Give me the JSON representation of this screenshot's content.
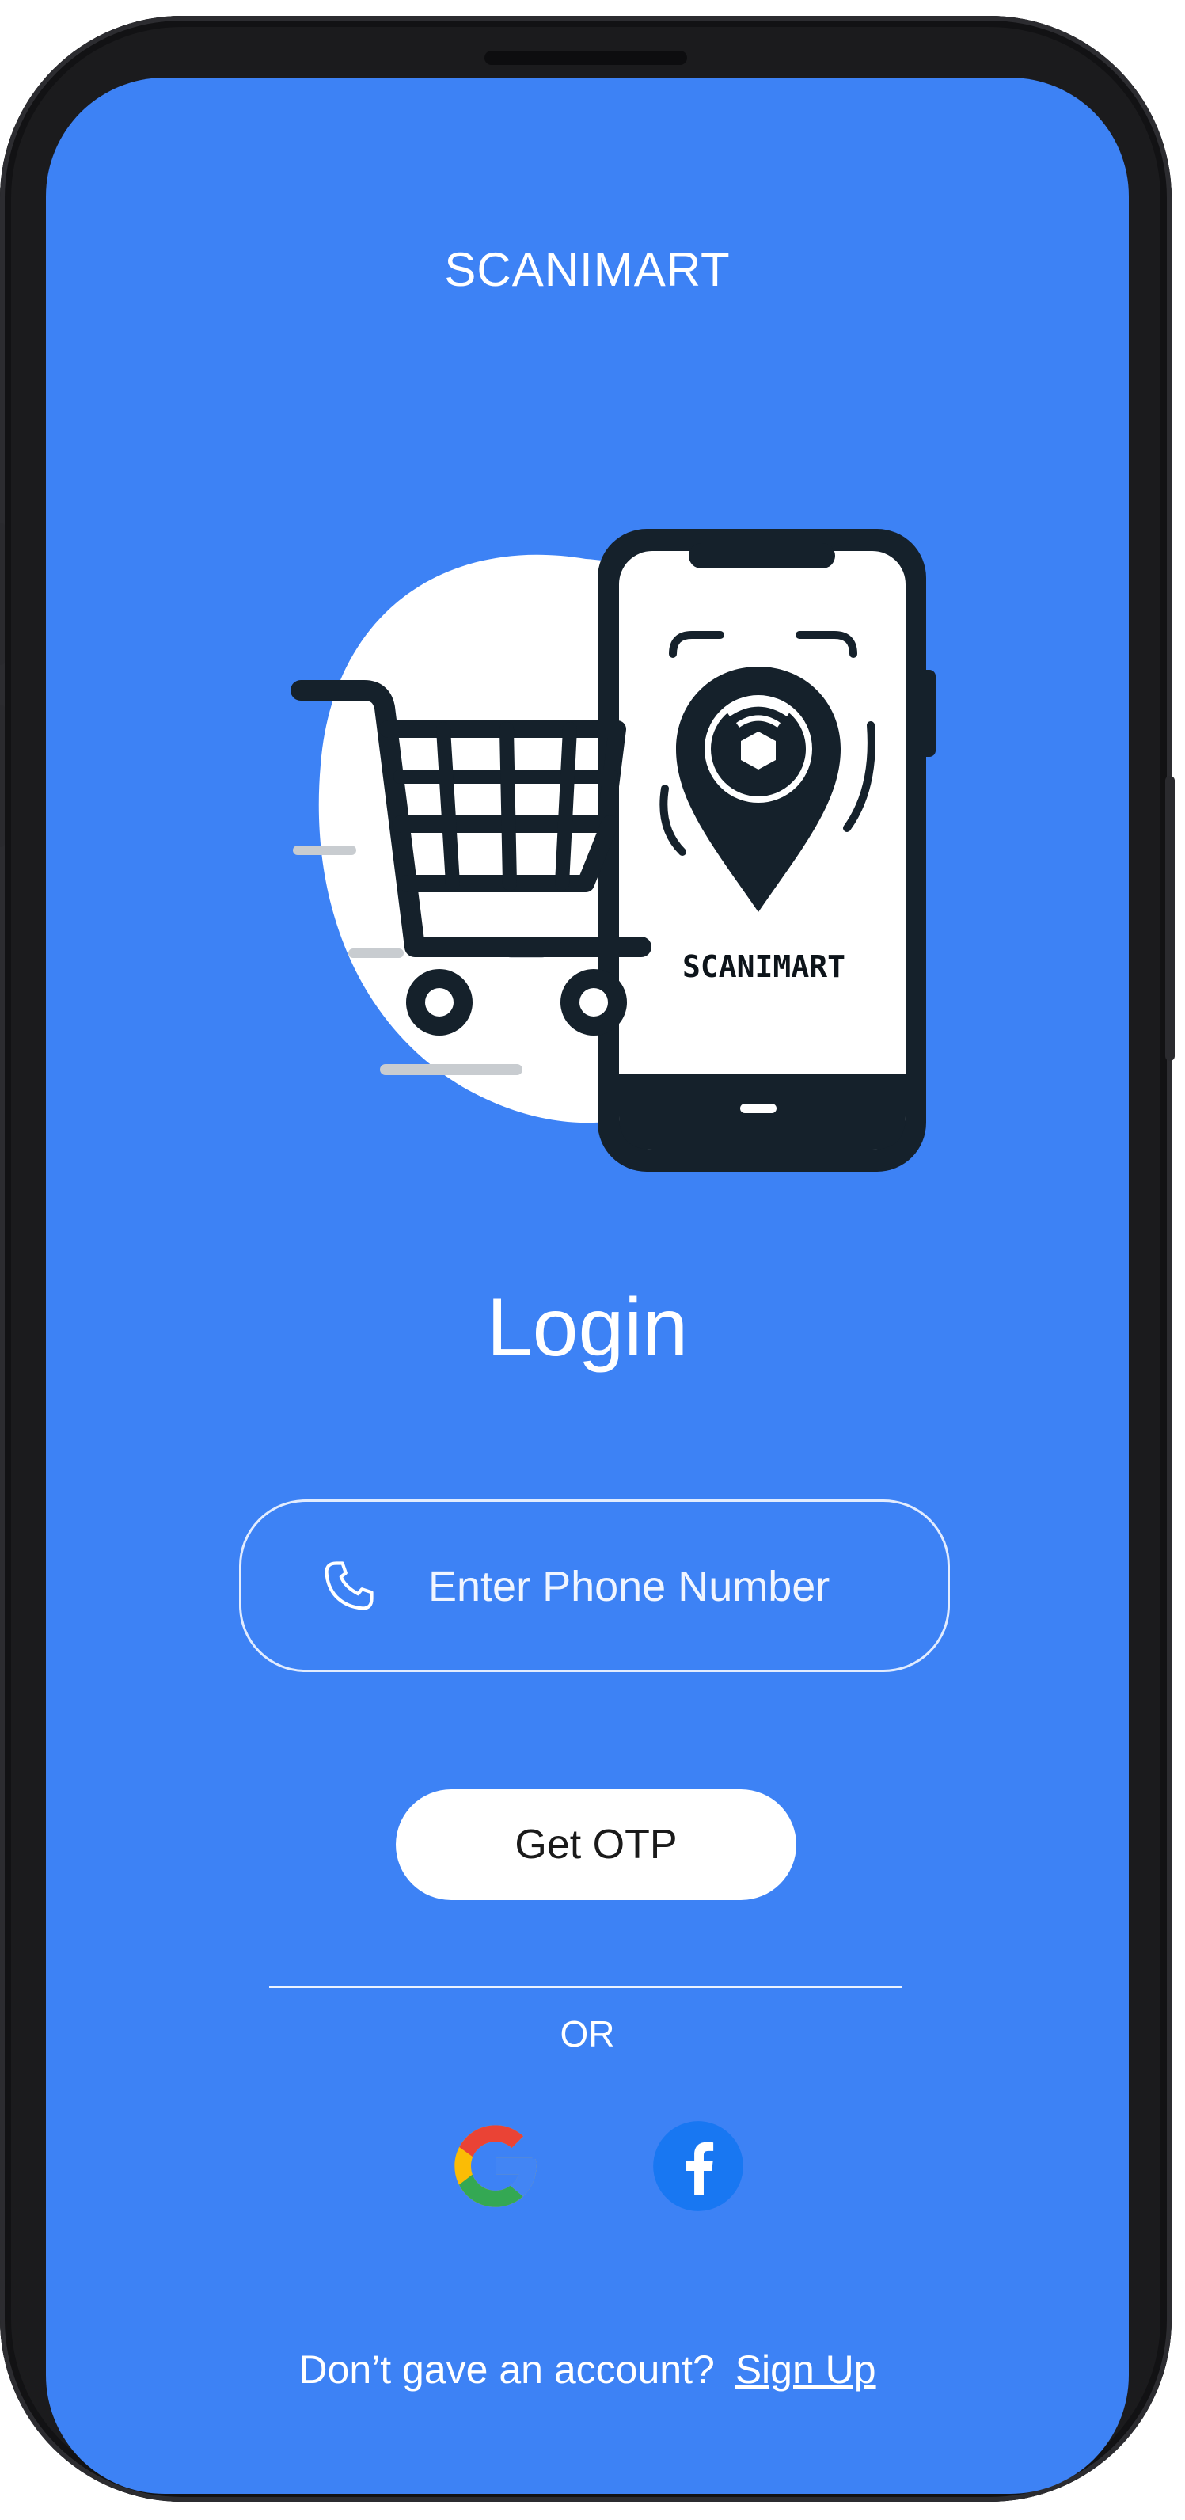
{
  "app": {
    "title": "SCANIMART",
    "logo_text": "SCANIMART"
  },
  "login": {
    "title": "Login",
    "phone_placeholder": "Enter Phone Number",
    "phone_value": "",
    "otp_button_label": "Get OTP",
    "or_label": "OR"
  },
  "social": {
    "google_icon": "google-logo",
    "facebook_icon": "facebook-logo"
  },
  "signup": {
    "prompt": "Don’t gave an account?",
    "link_label": "Sign Up"
  },
  "colors": {
    "screen_background": "#3d82f5",
    "device_frame": "#1b1b1d",
    "logo_dark": "#15212b",
    "facebook_blue": "#1877f2",
    "button_background": "#ffffff"
  }
}
